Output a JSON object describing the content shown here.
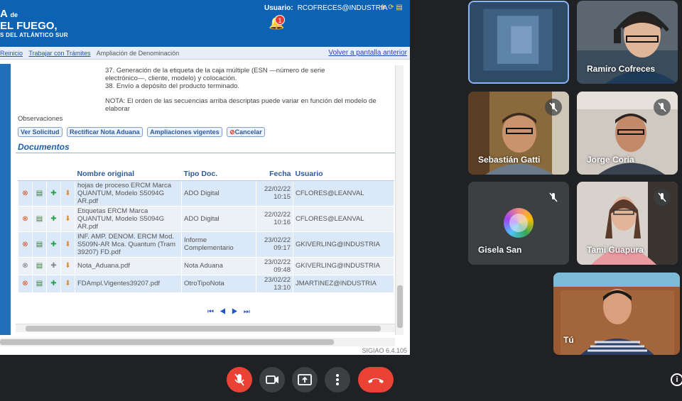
{
  "app": {
    "logo": {
      "line1": "A",
      "line1_small": "de",
      "line2": "EL FUEGO,",
      "line3": "S DEL ATLÁNTICO SUR"
    },
    "user_label": "Usuario:",
    "user_name": "RCOFRECES@INDUSTRIA",
    "notification_count": "1",
    "breadcrumb": [
      "Reinicio",
      "Trabajar con Trámites"
    ],
    "breadcrumb_current": "Ampliación de Denominación",
    "back_link": "Volver a pantalla anterior",
    "steps": [
      "37. Generación de la etiqueta de la caja múltiple (ESN —número de serie",
      "electrónico—, cliente, modelo) y colocación.",
      "38. Envío a depósito del producto terminado."
    ],
    "note": "NOTA: El orden de las secuencias arriba descriptas puede variar en función del modelo de elaborar",
    "observaciones_label": "Observaciones",
    "buttons": {
      "ver_solicitud": "Ver Solicitud",
      "rectificar": "Rectificar Nota Aduana",
      "ampliaciones": "Ampliaciones vigentes",
      "cancelar": "Cancelar"
    },
    "documents_title": "Documentos",
    "table": {
      "headers": {
        "nombre": "Nombre original",
        "tipo": "Tipo Doc.",
        "fecha": "Fecha",
        "usuario": "Usuario"
      },
      "rows": [
        {
          "nombre": "hojas de proceso ERCM Marca QUANTUM, Modelo S5094G AR.pdf",
          "tipo": "ADO Digital",
          "fecha": "22/02/22",
          "hora": "10:15",
          "usuario": "CFLORES@LEANVAL"
        },
        {
          "nombre": "Etiquetas ERCM Marca QUANTUM, Modelo S5094G AR.pdf",
          "tipo": "ADO Digital",
          "fecha": "22/02/22",
          "hora": "10:16",
          "usuario": "CFLORES@LEANVAL"
        },
        {
          "nombre": "INF. AMP. DENOM. ERCM Mod. S509N-AR Mca. Quantum (Tram 39207) FD.pdf",
          "tipo": "Informe Complementario",
          "fecha": "23/02/22",
          "hora": "09:17",
          "usuario": "GKIVERLING@INDUSTRIA"
        },
        {
          "nombre": "Nota_Aduana.pdf",
          "tipo": "Nota Aduana",
          "fecha": "23/02/22",
          "hora": "09:48",
          "usuario": "GKIVERLING@INDUSTRIA"
        },
        {
          "nombre": "FDAmpl.Vigentes39207.pdf",
          "tipo": "OtroTipoNota",
          "fecha": "23/02/22",
          "hora": "13:10",
          "usuario": "JMARTINEZ@INDUSTRIA"
        }
      ]
    },
    "version": "SIGIAO 6.4.105"
  },
  "participants": [
    {
      "name": "",
      "tile": "self-preview"
    },
    {
      "name": "Ramiro Cofreces"
    },
    {
      "name": "Sebastián Gatti"
    },
    {
      "name": "Jorge Coria"
    },
    {
      "name": "Gisela San"
    },
    {
      "name": "Tami Guapura"
    },
    {
      "name": "Tú"
    }
  ],
  "controls": {
    "icons": [
      "mic-off-icon",
      "camera-icon",
      "present-screen-icon",
      "more-options-icon",
      "end-call-icon",
      "info-icon"
    ],
    "accent_color": "#ea4335"
  }
}
